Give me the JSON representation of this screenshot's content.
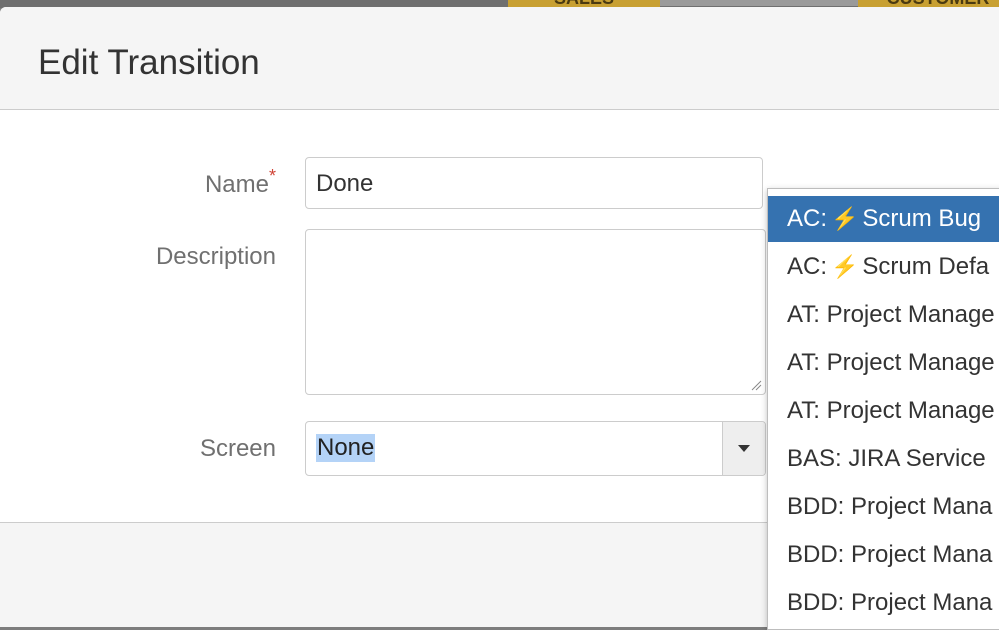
{
  "background": {
    "tab_sales": "SALES",
    "tab_customer": "CUSTOMER"
  },
  "dialog": {
    "title": "Edit Transition"
  },
  "form": {
    "name_label": "Name",
    "required_mark": "*",
    "name_value": "Done",
    "description_label": "Description",
    "description_value": "",
    "screen_label": "Screen",
    "screen_value": "None"
  },
  "dropdown": {
    "options": [
      {
        "prefix": "AC:",
        "icon": "lightning-icon",
        "glyph": "⚡",
        "text": "Scrum Bug",
        "selected": true
      },
      {
        "prefix": "AC:",
        "icon": "lightning-icon",
        "glyph": "⚡",
        "text": "Scrum Defa",
        "selected": false
      },
      {
        "prefix": "",
        "icon": "",
        "glyph": "",
        "text": "AT: Project Manage",
        "selected": false
      },
      {
        "prefix": "",
        "icon": "",
        "glyph": "",
        "text": "AT: Project Manage",
        "selected": false
      },
      {
        "prefix": "",
        "icon": "",
        "glyph": "",
        "text": "AT: Project Manage",
        "selected": false
      },
      {
        "prefix": "",
        "icon": "",
        "glyph": "",
        "text": "BAS: JIRA Service",
        "selected": false
      },
      {
        "prefix": "",
        "icon": "",
        "glyph": "",
        "text": "BDD: Project Mana",
        "selected": false
      },
      {
        "prefix": "",
        "icon": "",
        "glyph": "",
        "text": "BDD: Project Mana",
        "selected": false
      },
      {
        "prefix": "",
        "icon": "",
        "glyph": "",
        "text": "BDD: Project Mana",
        "selected": false
      }
    ]
  },
  "colors": {
    "accent": "#3572b0",
    "required": "#d04437",
    "highlight": "#b4d3f7"
  }
}
